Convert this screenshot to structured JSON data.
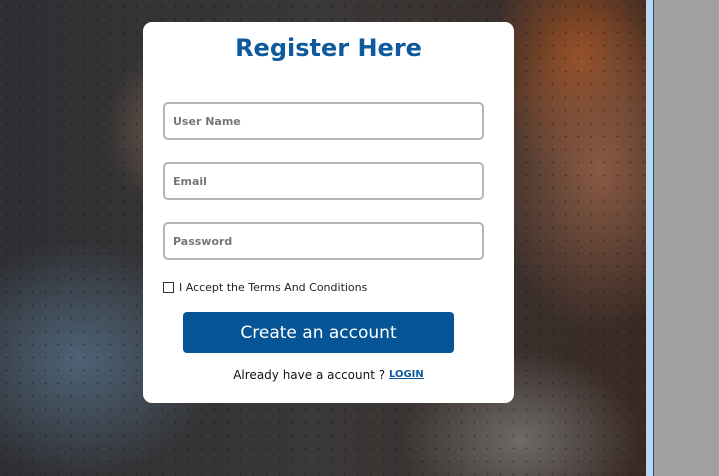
{
  "form": {
    "title": "Register Here",
    "username_placeholder": "User Name",
    "email_placeholder": "Email",
    "password_placeholder": "Password",
    "terms_label": "I Accept the Terms And Conditions",
    "submit_label": "Create an account",
    "already_text": "Already have a account ?",
    "login_label": "LOGIN"
  },
  "colors": {
    "accent": "#055596",
    "title": "#0f5a9c"
  }
}
